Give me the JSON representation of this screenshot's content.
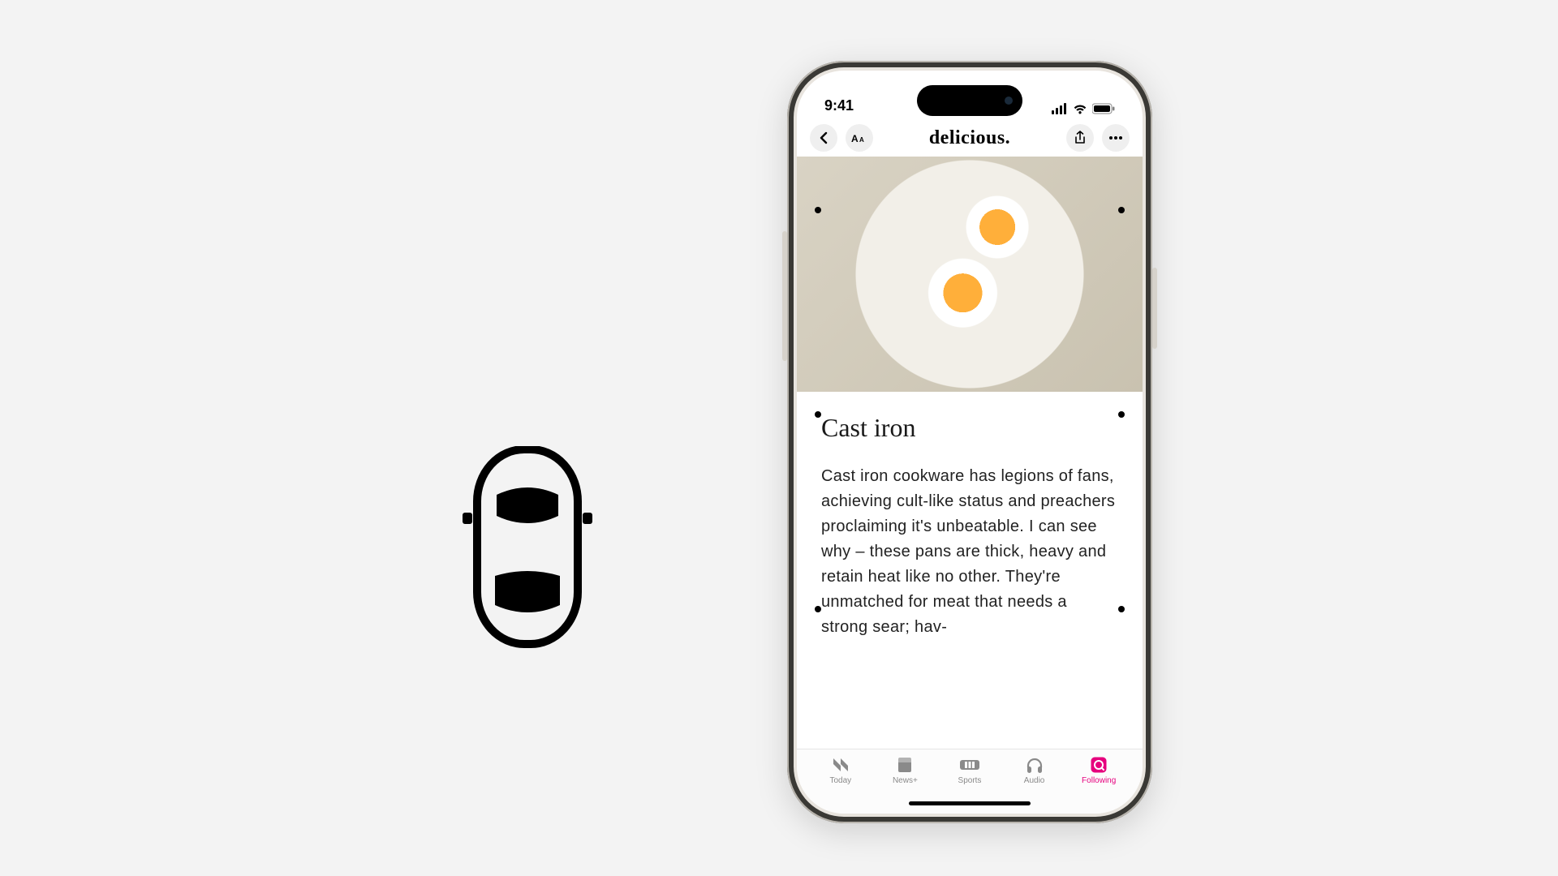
{
  "status": {
    "time": "9:41"
  },
  "nav": {
    "title": "delicious."
  },
  "article": {
    "title": "Cast iron",
    "body": "Cast iron cookware has legions of fans, achieving cult-like status and preachers proclaiming it's unbeatable. I can see why – these pans are thick, heavy and retain heat like no other. They're unmatched for meat that needs a strong sear; hav-"
  },
  "tabs": {
    "today": "Today",
    "newsplus": "News+",
    "sports": "Sports",
    "audio": "Audio",
    "following": "Following"
  }
}
